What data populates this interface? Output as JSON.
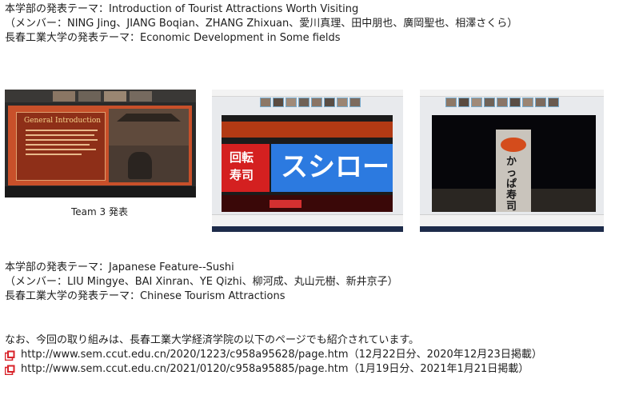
{
  "section1": {
    "line1": "本学部の発表テーマ：Introduction of Tourist Attractions Worth Visiting",
    "line2": "（メンバー：NING Jing、JIANG Boqian、ZHANG Zhixuan、愛川真理、田中朋也、廣岡聖也、相澤さくら）",
    "line3": "長春工業大学の発表テーマ：Economic Development in Some fields"
  },
  "photos": {
    "caption1": "Team 3 発表",
    "slide_title": "General Introduction",
    "sign1_line1": "回転",
    "sign1_line2": "寿司",
    "sign2_text": "スシロー",
    "sign3_text": "かっぱ寿司"
  },
  "section2": {
    "line1": "本学部の発表テーマ：Japanese Feature--Sushi",
    "line2": "（メンバー：LIU Mingye、BAI Xinran、YE Qizhi、柳河成、丸山元樹、新井京子）",
    "line3": "長春工業大学の発表テーマ：Chinese Tourism Attractions"
  },
  "footer": {
    "intro": "なお、今回の取り組みは、長春工業大学経済学院の以下のページでも紹介されています。",
    "links": [
      {
        "url": "http://www.sem.ccut.edu.cn/2020/1223/c958a95628/page.htm",
        "note": "（12月22日分、2020年12月23日掲載）"
      },
      {
        "url": "http://www.sem.ccut.edu.cn/2021/0120/c958a95885/page.htm",
        "note": "（1月19日分、2021年1月21日掲載）"
      }
    ]
  },
  "colors": {
    "link_icon": "#d8232a",
    "slide_bg": "#c8502a",
    "sign_red": "#d42020",
    "sign_blue": "#2c7ae0"
  }
}
